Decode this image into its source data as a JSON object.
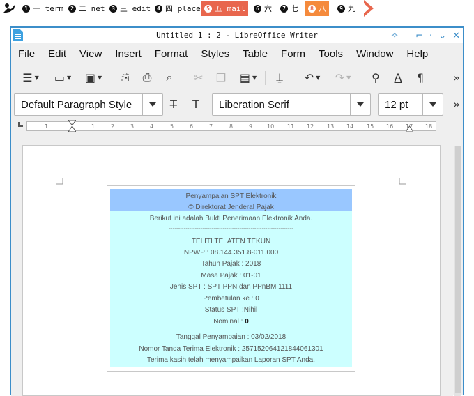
{
  "workspace_bar": {
    "workspaces": [
      {
        "num": "1",
        "label": "一 term",
        "state": "normal"
      },
      {
        "num": "2",
        "label": "二 net",
        "state": "normal"
      },
      {
        "num": "3",
        "label": "三 edit",
        "state": "normal"
      },
      {
        "num": "4",
        "label": "四 place",
        "state": "normal"
      },
      {
        "num": "5",
        "label": "五 mail",
        "state": "active"
      },
      {
        "num": "6",
        "label": "六",
        "state": "normal"
      },
      {
        "num": "7",
        "label": "七",
        "state": "normal"
      },
      {
        "num": "8",
        "label": "八",
        "state": "urgent"
      },
      {
        "num": "9",
        "label": "九",
        "state": "normal"
      }
    ]
  },
  "window": {
    "title": "Untitled 1 : 2 - LibreOffice Writer",
    "controls": [
      "sticky-icon",
      "minimize-icon",
      "maximize-icon",
      "shade-icon",
      "menu-down-icon",
      "close-icon"
    ]
  },
  "menubar": {
    "items": [
      "File",
      "Edit",
      "View",
      "Insert",
      "Format",
      "Styles",
      "Table",
      "Form",
      "Tools",
      "Window",
      "Help"
    ]
  },
  "formatting": {
    "paragraph_style": "Default Paragraph Style",
    "font_name": "Liberation Serif",
    "font_size": "12 pt"
  },
  "ruler": {
    "ticks": [
      "1",
      "1",
      "2",
      "3",
      "4",
      "5",
      "6",
      "7",
      "8",
      "9",
      "10",
      "11",
      "12",
      "13",
      "14",
      "15",
      "16",
      "17",
      "18"
    ]
  },
  "receipt": {
    "header1": "Penyampaian SPT Elektronik",
    "header2": "© Direktorat Jenderal Pajak",
    "intro": "Berikut ini adalah Bukti Penerimaan Elektronik Anda.",
    "divider": "-------------------------------------------------------------------",
    "name": "TELITI TELATEN TEKUN",
    "npwp": "NPWP : 08.144.351.8-011.000",
    "tahun": "Tahun Pajak : 2018",
    "masa": "Masa Pajak : 01-01",
    "jenis": "Jenis SPT : SPT PPN dan PPnBM 1111",
    "pembetulan": "Pembetulan ke : 0",
    "status": "Status SPT :Nihil",
    "nominal_label": "Nominal : ",
    "nominal_value": "0",
    "tanggal": "Tanggal Penyampaian : 03/02/2018",
    "nomor": "Nomor Tanda Terima Elektronik : 257152064121844061301",
    "thanks": "Terima kasih telah menyampaikan Laporan SPT Anda."
  },
  "colors": {
    "accent": "#3c8ec9",
    "active_workspace": "#e8664d",
    "urgent_workspace": "#f58a3c",
    "receipt_header": "#99c7ff",
    "receipt_body": "#ccffff"
  }
}
